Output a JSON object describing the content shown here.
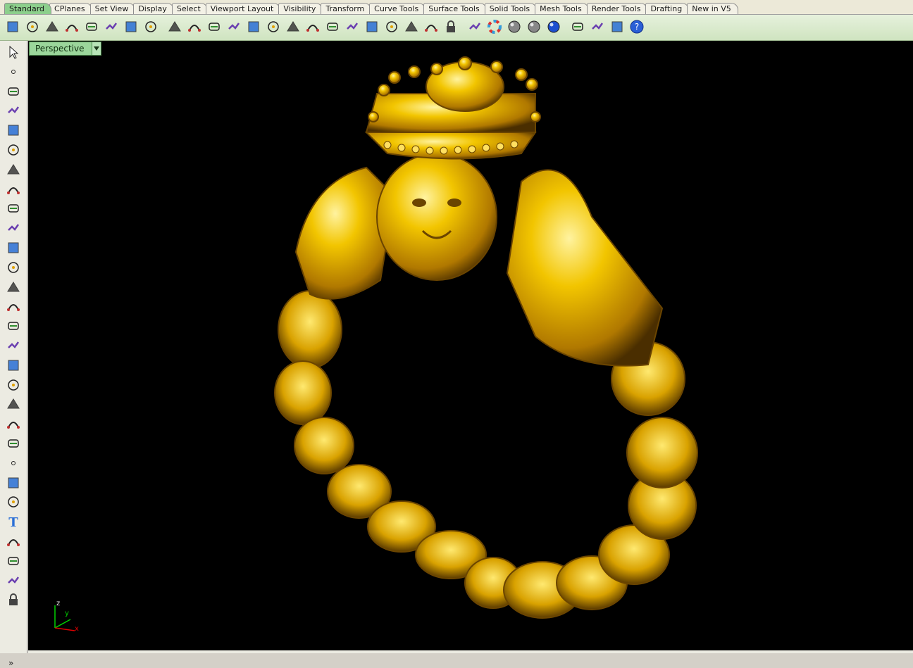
{
  "tabs": [
    "Standard",
    "CPlanes",
    "Set View",
    "Display",
    "Select",
    "Viewport Layout",
    "Visibility",
    "Transform",
    "Curve Tools",
    "Surface Tools",
    "Solid Tools",
    "Mesh Tools",
    "Render Tools",
    "Drafting",
    "New in V5"
  ],
  "active_tab": "Standard",
  "toolbar_icons": [
    "new-icon",
    "open-icon",
    "save-icon",
    "print-icon",
    "import-icon",
    "cut-icon",
    "copy-icon",
    "paste-icon",
    "undo-icon",
    "pan-hand-icon",
    "rotate-view-icon",
    "zoom-window-icon",
    "zoom-dynamic-icon",
    "zoom-extents-icon",
    "zoom-selected-icon",
    "undo-view-icon",
    "four-viewports-icon",
    "car-object-icon",
    "grid-icon",
    "circle-target-icon",
    "osnap-icon",
    "light-bulb-icon",
    "lock-icon",
    "material-icon",
    "color-wheel-icon",
    "shaded-sphere-icon",
    "rendered-sphere-icon",
    "blue-sphere-icon",
    "filter-icon",
    "settings-icon",
    "dimension-icon",
    "help-icon"
  ],
  "left_icons": [
    "select-arrow-icon",
    "point-icon",
    "polyline-icon",
    "curve-icon",
    "circle-icon",
    "ellipse-icon",
    "polygon-icon",
    "rectangle-icon",
    "free-polygon-icon",
    "fillet-icon",
    "surface-icon",
    "extrude-icon",
    "box-icon",
    "boolean-icon",
    "cylinder-icon",
    "surface-grid-icon",
    "gear-icon",
    "transform-icon",
    "split-icon",
    "cut-plane-icon",
    "group-icon",
    "point-edit-icon",
    "curve-edit-icon",
    "offset-icon",
    "text-icon",
    "dimension-icon",
    "array-icon",
    "orient-icon",
    "block-icon"
  ],
  "more_label": "»",
  "viewport": {
    "name": "Perspective"
  },
  "axis": {
    "x": "x",
    "y": "y",
    "z": "z"
  },
  "colors": {
    "tab_active": "#8ccf8c",
    "viewport_bg": "#000000",
    "gold": "#e8b400"
  }
}
